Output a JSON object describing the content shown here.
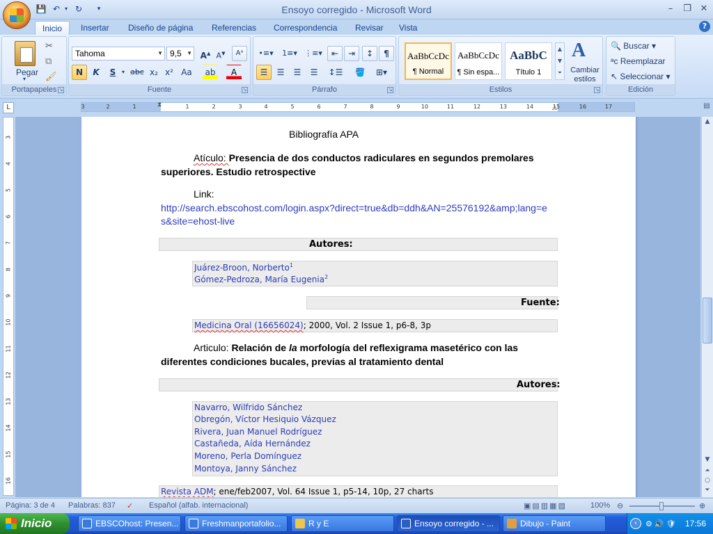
{
  "window": {
    "title": "Ensoyo corregido - Microsoft Word"
  },
  "qat": {
    "save": "save-icon",
    "undo": "undo-icon",
    "redo": "redo-icon"
  },
  "tabs": [
    "Inicio",
    "Insertar",
    "Diseño de página",
    "Referencias",
    "Correspondencia",
    "Revisar",
    "Vista"
  ],
  "ribbon": {
    "clipboard": {
      "label": "Portapapeles",
      "paste": "Pegar"
    },
    "font": {
      "label": "Fuente",
      "name": "Tahoma",
      "size": "9,5",
      "bold": "N",
      "italic": "K",
      "underline": "S",
      "strike": "abc",
      "sub": "x₂",
      "sup": "x²",
      "case": "Aa"
    },
    "paragraph": {
      "label": "Párrafo"
    },
    "styles": {
      "label": "Estilos",
      "items": [
        {
          "sample": "AaBbCcDc",
          "name": "¶ Normal"
        },
        {
          "sample": "AaBbCcDc",
          "name": "¶ Sin espa..."
        },
        {
          "sample": "AaBbC",
          "name": "Título 1"
        }
      ],
      "change": "Cambiar estilos"
    },
    "editing": {
      "label": "Edición",
      "find": "Buscar",
      "replace": "Reemplazar",
      "select": "Seleccionar"
    }
  },
  "ruler": {
    "ticks": [
      "3",
      "2",
      "1",
      "1",
      "2",
      "3",
      "4",
      "5",
      "6",
      "7",
      "8",
      "9",
      "10",
      "11",
      "12",
      "13",
      "14",
      "15",
      "16",
      "17"
    ]
  },
  "vruler": {
    "ticks": [
      "3",
      "4",
      "5",
      "6",
      "7",
      "8",
      "9",
      "10",
      "11",
      "12",
      "13",
      "14",
      "15",
      "16"
    ]
  },
  "document": {
    "heading": "Bibliografía APA",
    "article1": {
      "prefix": "Atículo: ",
      "title_line1": "Presencia de dos conductos radiculares en segundos premolares",
      "title_line2": "superiores. Estudio retrospective"
    },
    "link": {
      "label": "Link:",
      "line1": "http://search.ebscohost.com/login.aspx?direct=true&db=ddh&AN=25576192&amp;lang=e",
      "line2": "s&site=ehost-live"
    },
    "autores1_label": "Autores:",
    "autores1": [
      "Juárez-Broon, Norberto",
      "Gómez-Pedroza, María Eugenia"
    ],
    "autores1_sup": [
      "1",
      "2"
    ],
    "fuente_label": "Fuente:",
    "fuente_source": "Medicina Oral (16656024)",
    "fuente_rest": "; 2000, Vol. 2 Issue 1, p6-8, 3p",
    "article2": {
      "prefix": "Articulo: ",
      "t1": "Relación de ",
      "t1_italic": "la",
      "t2": " morfología del reflexigrama masetérico con las",
      "line2": "diferentes condiciones bucales, previas al tratamiento dental"
    },
    "autores2_label": "Autores:",
    "autores2": [
      "Navarro, Wilfrido Sánchez",
      "Obregón, Víctor Hesiquio Vázquez",
      "Rivera, Juan Manuel Rodríguez",
      "Castañeda, Aída Hernández",
      "Moreno, Perla Domínguez",
      "Montoya, Janny Sánchez"
    ],
    "revista_source": "Revista ADM",
    "revista_rest": "; ene/feb2007, Vol. 64 Issue 1, p5-14, 10p, 27 charts"
  },
  "status": {
    "page": "Página: 3 de 4",
    "words": "Palabras: 837",
    "language": "Español (alfab. internacional)",
    "zoom": "100%"
  },
  "taskbar": {
    "start": "Inicio",
    "tasks": [
      "EBSCOhost: Presen...",
      "Freshmanportafolio...",
      "R y E",
      "Ensoyo corregido - ...",
      "Dibujo - Paint"
    ],
    "clock": "17:56"
  },
  "colors": {
    "link": "#2a3bb5",
    "ribbon_bg": "#d3e3f8",
    "taskbar": "#245edb"
  }
}
